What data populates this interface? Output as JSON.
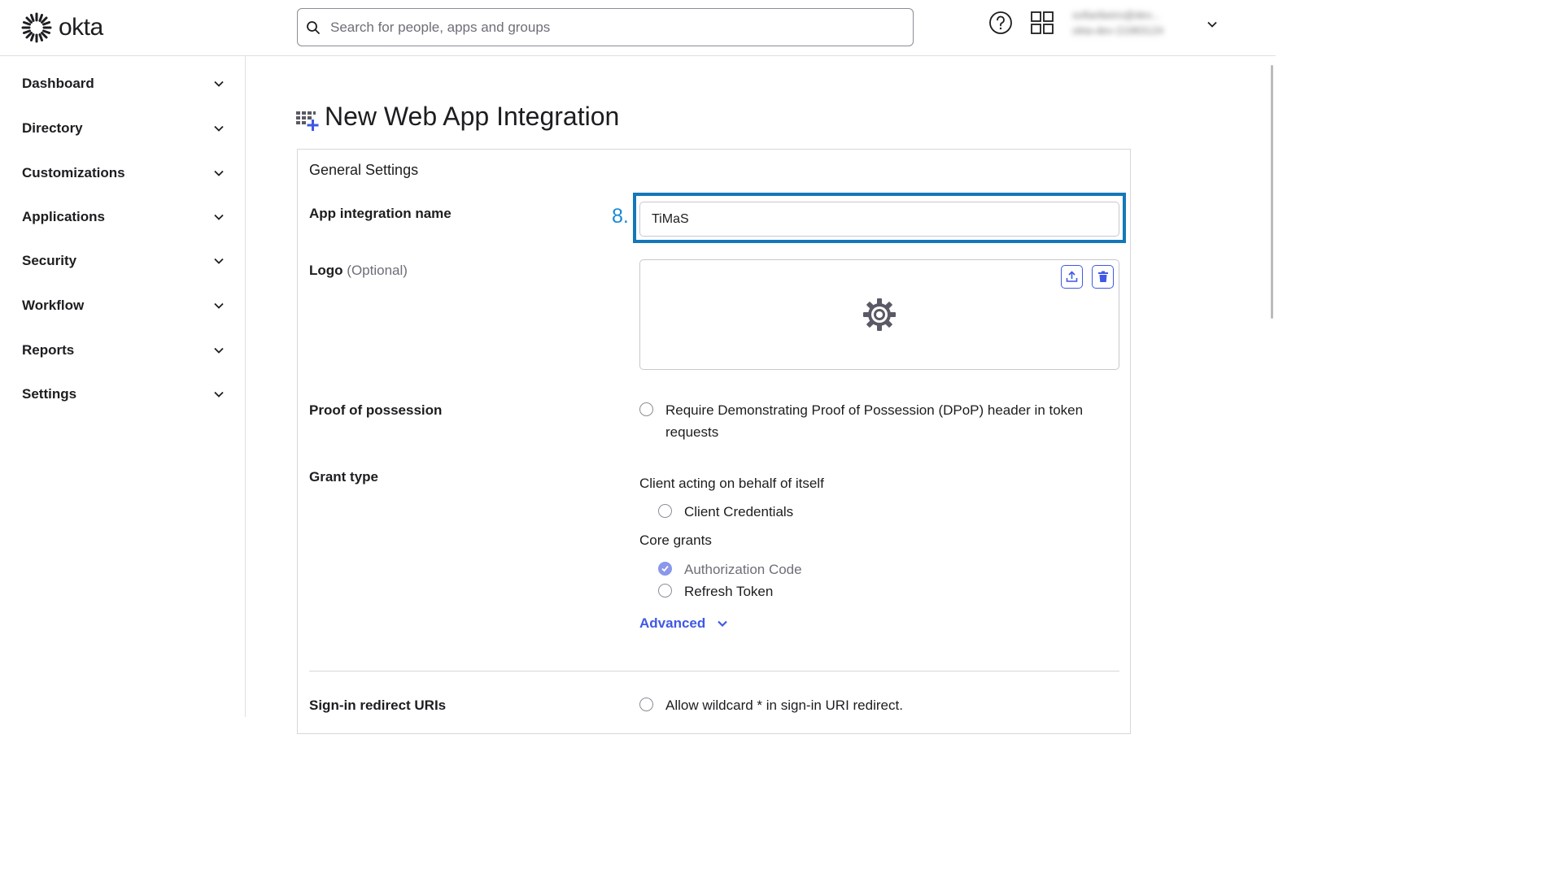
{
  "app": {
    "brand": "okta"
  },
  "header": {
    "search_placeholder": "Search for people, apps and groups",
    "user_email": "sofiaribeiro@dev...",
    "user_org": "okta-dev-21983124"
  },
  "sidebar": {
    "items": [
      {
        "label": "Dashboard"
      },
      {
        "label": "Directory"
      },
      {
        "label": "Customizations"
      },
      {
        "label": "Applications"
      },
      {
        "label": "Security"
      },
      {
        "label": "Workflow"
      },
      {
        "label": "Reports"
      },
      {
        "label": "Settings"
      }
    ]
  },
  "main": {
    "title": "New Web App Integration",
    "section_title": "General Settings",
    "step_marker": "8.",
    "app_name": {
      "label": "App integration name",
      "value": "TiMaS"
    },
    "logo": {
      "label": "Logo",
      "optional": "(Optional)"
    },
    "proof": {
      "label": "Proof of possession",
      "option_line1": "Require Demonstrating Proof of Possession (DPoP) header in token",
      "option_line2": "requests",
      "checked": false
    },
    "grant_type": {
      "label": "Grant type",
      "client_heading": "Client acting on behalf of itself",
      "client_credentials": "Client Credentials",
      "core_heading": "Core grants",
      "authorization_code": "Authorization Code",
      "refresh_token": "Refresh Token",
      "advanced": "Advanced"
    },
    "signin": {
      "label": "Sign-in redirect URIs",
      "wildcard": "Allow wildcard * in sign-in URI redirect."
    }
  },
  "colors": {
    "accent": "#3f59e4",
    "highlight": "#1478b8",
    "step": "#1c8ad6",
    "checked": "#8a97ea"
  }
}
